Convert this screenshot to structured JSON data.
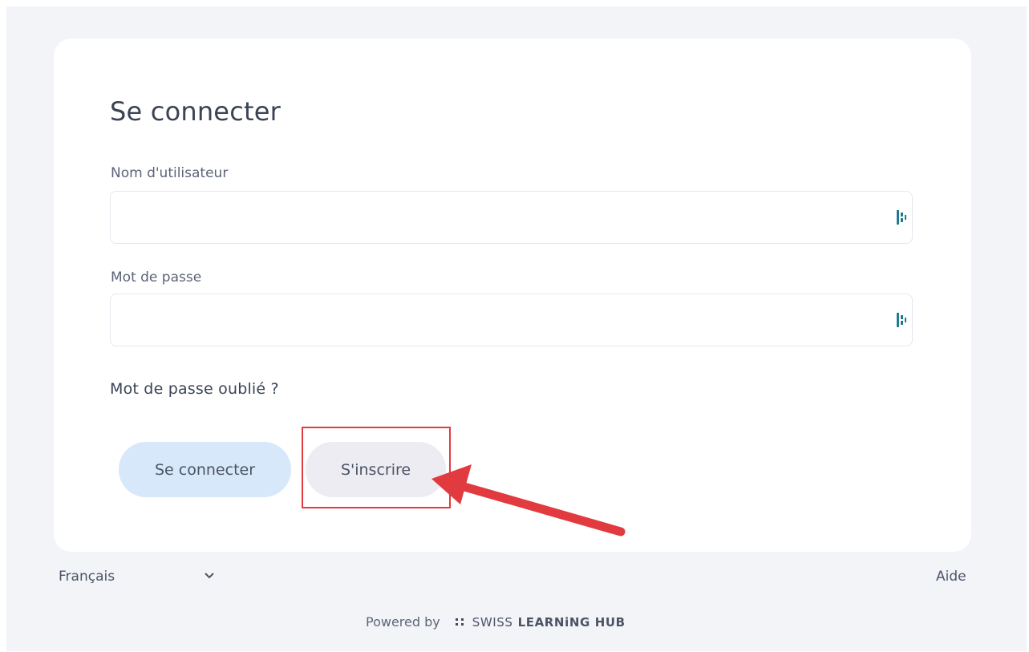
{
  "login": {
    "title": "Se connecter",
    "username_label": "Nom d'utilisateur",
    "username_value": "",
    "password_label": "Mot de passe",
    "password_value": "",
    "forgot_link": "Mot de passe oublié ?",
    "login_button": "Se connecter",
    "signup_button": "S'inscrire"
  },
  "footer": {
    "language": "Français",
    "help": "Aide",
    "powered_by": "Powered by",
    "brand_part1": "SWISS",
    "brand_part2": "LEARNiNG HUB"
  },
  "colors": {
    "login_button_bg": "#d8e8fb",
    "signup_button_bg": "#ececf2",
    "annotation": "#e23b3f",
    "icon_accent": "#1f7a8c"
  },
  "icons": {
    "input_icon": "password-manager-icon",
    "language_chevron": "chevron-down-icon",
    "brand_logo": "dots-logo-icon"
  }
}
